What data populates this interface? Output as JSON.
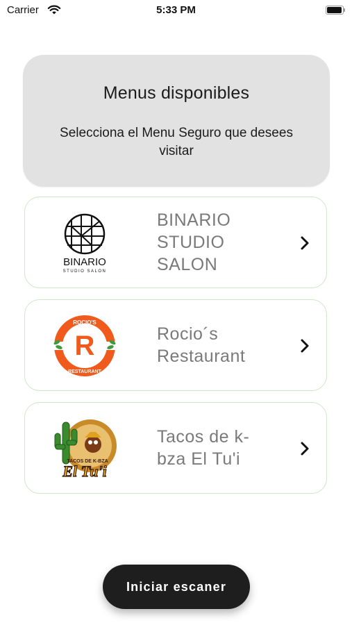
{
  "status_bar": {
    "carrier": "Carrier",
    "time": "5:33 PM"
  },
  "header": {
    "title": "Menus disponibles",
    "subtitle": "Selecciona el Menu Seguro que desees visitar"
  },
  "menus": [
    {
      "name": "BINARIO STUDIO SALON",
      "logo_text": "BINARIO",
      "logo_subtext": "STUDIO SALON"
    },
    {
      "name": "Rocio´s Restaurant",
      "logo_text": "R",
      "logo_top": "ROCIO'S",
      "logo_bottom": "RESTAURANT"
    },
    {
      "name": "Tacos de k-bza El Tu'i",
      "logo_text": "El Tu'i",
      "logo_top": "TACOS DE K-BZA"
    }
  ],
  "scan_button": {
    "label": "Iniciar escaner"
  },
  "colors": {
    "header_bg": "#e2e2e2",
    "card_border": "#cfe6c8",
    "menu_text": "#7a7a7a",
    "button_bg": "#1e1e1e",
    "rocio_orange": "#f05a1c",
    "rocio_green": "#3d9a3d"
  }
}
